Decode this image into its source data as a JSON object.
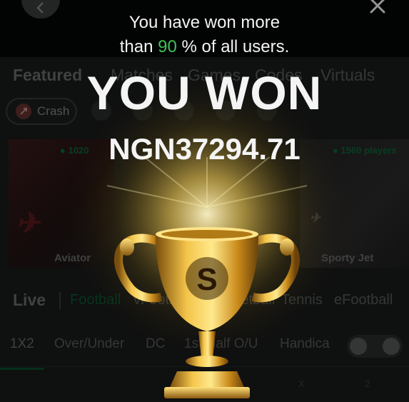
{
  "overlay": {
    "message_prefix": "You have won more",
    "message_line2_prefix": "than ",
    "percent": "90",
    "message_line2_suffix": " % of all users.",
    "headline": "YOU WON",
    "amount": "NGN37294.71",
    "trophy_icon": "trophy-icon"
  },
  "nav": {
    "tabs": [
      "Featured",
      "Matches",
      "Games",
      "Codes",
      "Virtuals"
    ]
  },
  "categories": {
    "crash_label": "Crash"
  },
  "games": [
    {
      "name": "Aviator",
      "players": "1020"
    },
    {
      "name": "Sporty Jet",
      "players": "1560 players"
    }
  ],
  "live": {
    "title": "Live",
    "sports": [
      "Football",
      "vFootball",
      "Basketball",
      "Tennis",
      "eFootball"
    ]
  },
  "markets": {
    "items": [
      "1X2",
      "Over/Under",
      "DC",
      "1st Half O/U",
      "Handica"
    ]
  },
  "odds_headers": [
    "X",
    "2"
  ],
  "colors": {
    "accent_green": "#3fc35a",
    "background": "#0d0f0e"
  }
}
